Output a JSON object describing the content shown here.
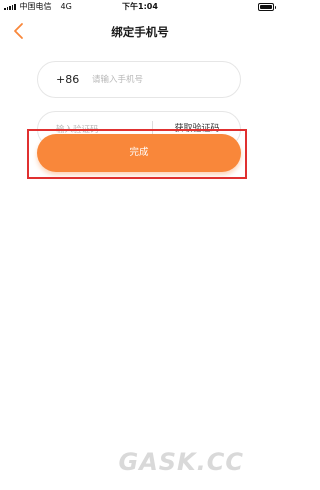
{
  "status_bar": {
    "carrier": "中国电信",
    "network": "4G",
    "time": "下午1:04",
    "battery_level": 1.0
  },
  "nav": {
    "back_icon": "chevron-left-icon",
    "title": "绑定手机号",
    "accent_color": "#f9873a"
  },
  "phone_field": {
    "country_code": "+86",
    "placeholder": "请输入手机号",
    "value": ""
  },
  "code_field": {
    "placeholder": "输入验证码",
    "value": "",
    "get_code_label": "获取验证码"
  },
  "submit": {
    "label": "完成",
    "color": "#f9873a",
    "highlight_color": "#e03030"
  },
  "watermark": {
    "text": "GASK.CC"
  }
}
